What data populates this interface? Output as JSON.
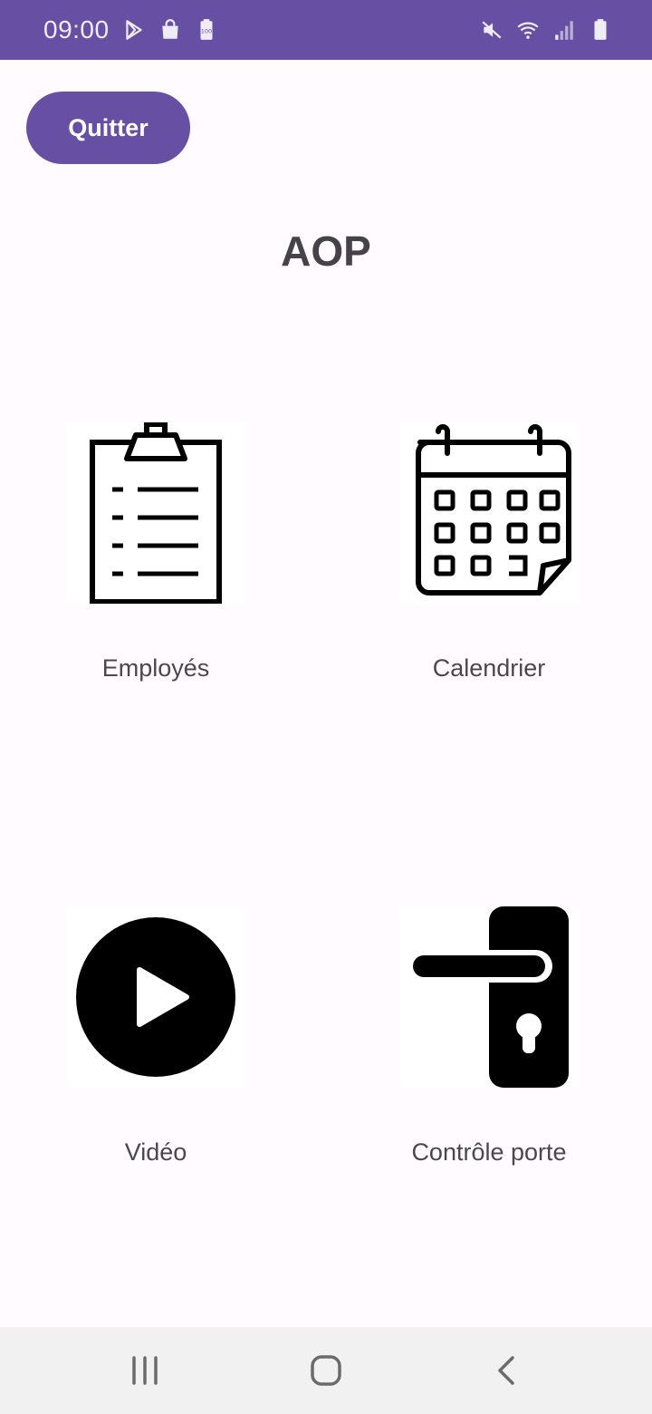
{
  "status_bar": {
    "time": "09:00",
    "left_icons": [
      "play-store-icon",
      "shopping-bag-icon",
      "battery-saver-icon"
    ],
    "right_icons": [
      "mute-icon",
      "wifi-icon",
      "signal-icon",
      "battery-icon"
    ]
  },
  "header": {
    "quit_label": "Quitter",
    "title": "AOP"
  },
  "tiles": [
    {
      "label": "Employés",
      "icon": "clipboard-list-icon"
    },
    {
      "label": "Calendrier",
      "icon": "calendar-icon"
    },
    {
      "label": "Vidéo",
      "icon": "play-circle-icon"
    },
    {
      "label": "Contrôle porte",
      "icon": "door-handle-icon"
    }
  ],
  "nav_bar": {
    "buttons": [
      "recent-apps-icon",
      "home-icon",
      "back-icon"
    ]
  },
  "colors": {
    "accent": "#6750a4",
    "background": "#fffbfe",
    "nav_background": "#f1f1f1"
  }
}
